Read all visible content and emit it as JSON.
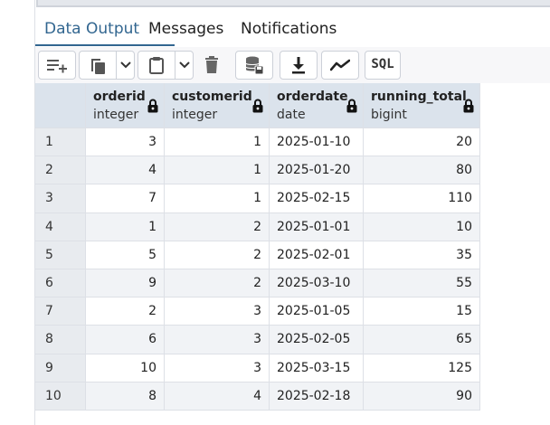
{
  "tabs": [
    {
      "label": "Data Output",
      "active": true
    },
    {
      "label": "Messages",
      "active": false
    },
    {
      "label": "Notifications",
      "active": false
    }
  ],
  "toolbar": {
    "buttons": [
      {
        "name": "add-row-icon"
      },
      {
        "name": "copy-icon"
      },
      {
        "name": "chevron-down-icon"
      },
      {
        "name": "paste-icon"
      },
      {
        "name": "chevron-down-icon"
      },
      {
        "name": "delete-icon"
      },
      {
        "name": "save-data-icon"
      },
      {
        "name": "download-icon"
      },
      {
        "name": "graph-icon"
      }
    ],
    "sql_label": "SQL"
  },
  "table": {
    "columns": [
      {
        "name": "orderid",
        "type": "integer",
        "align": "right"
      },
      {
        "name": "customerid",
        "type": "integer",
        "align": "right"
      },
      {
        "name": "orderdate",
        "type": "date",
        "align": "left"
      },
      {
        "name": "running_total",
        "type": "bigint",
        "align": "right"
      }
    ],
    "rows": [
      {
        "n": "1",
        "cells": [
          "3",
          "1",
          "2025-01-10",
          "20"
        ]
      },
      {
        "n": "2",
        "cells": [
          "4",
          "1",
          "2025-01-20",
          "80"
        ]
      },
      {
        "n": "3",
        "cells": [
          "7",
          "1",
          "2025-02-15",
          "110"
        ]
      },
      {
        "n": "4",
        "cells": [
          "1",
          "2",
          "2025-01-01",
          "10"
        ]
      },
      {
        "n": "5",
        "cells": [
          "5",
          "2",
          "2025-02-01",
          "35"
        ]
      },
      {
        "n": "6",
        "cells": [
          "9",
          "2",
          "2025-03-10",
          "55"
        ]
      },
      {
        "n": "7",
        "cells": [
          "2",
          "3",
          "2025-01-05",
          "15"
        ]
      },
      {
        "n": "8",
        "cells": [
          "6",
          "3",
          "2025-02-05",
          "65"
        ]
      },
      {
        "n": "9",
        "cells": [
          "10",
          "3",
          "2025-03-15",
          "125"
        ]
      },
      {
        "n": "10",
        "cells": [
          "8",
          "4",
          "2025-02-18",
          "90"
        ]
      }
    ]
  },
  "colors": {
    "accent": "#326690",
    "header_bg": "#dbe3ec",
    "stripe": "#f1f3f6"
  }
}
